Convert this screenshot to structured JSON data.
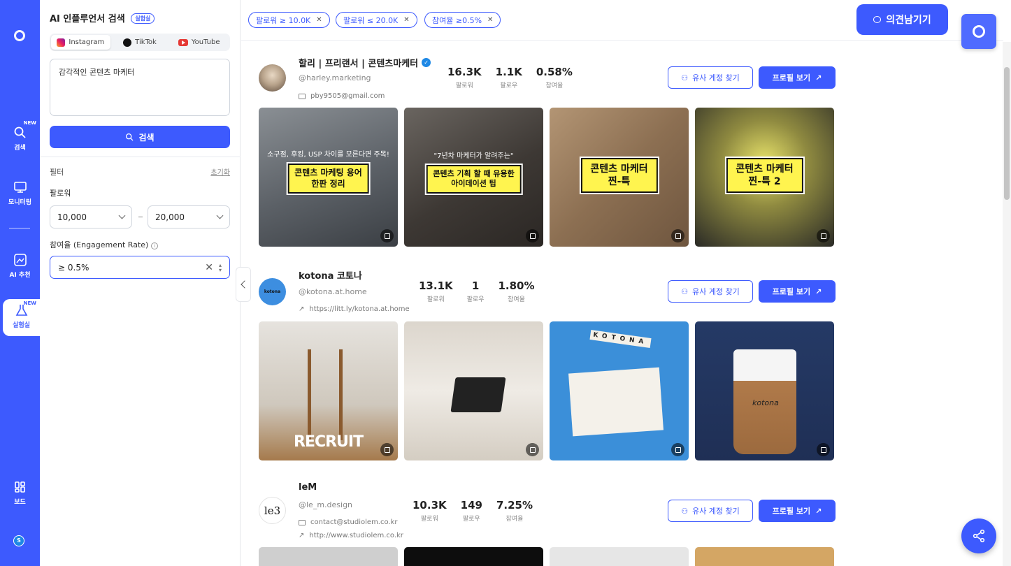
{
  "nav": {
    "items": [
      {
        "label": "검색",
        "badge": "NEW"
      },
      {
        "label": "모니터링",
        "badge": ""
      },
      {
        "label": "AI 추천",
        "badge": ""
      },
      {
        "label": "실험실",
        "badge": "NEW"
      },
      {
        "label": "보드",
        "badge": ""
      }
    ],
    "avatar": "S"
  },
  "panel": {
    "title": "AI 인플루언서 검색",
    "beta": "실험실",
    "platforms": [
      "Instagram",
      "TikTok",
      "YouTube"
    ],
    "query": "감각적인 콘텐츠 마케터",
    "search_label": "검색",
    "filter_label": "필터",
    "reset_label": "초기화",
    "followers_label": "팔로워",
    "followers_min": "10,000",
    "followers_max": "20,000",
    "engagement_label": "참여율 (Engagement Rate)",
    "engagement_value": "≥ 0.5%"
  },
  "chips": [
    "팔로워 ≥ 10.0K",
    "팔로워 ≤ 20.0K",
    "참여율 ≥0.5%"
  ],
  "feedback_label": "의견남기기",
  "buttons": {
    "similar": "유사 계정 찾기",
    "profile": "프로필 보기"
  },
  "stat_labels": {
    "followers": "팔로워",
    "following": "팔로우",
    "engagement": "참여율"
  },
  "profiles": [
    {
      "name": "할리 | 프리랜서 | 콘텐츠마케터",
      "handle": "@harley.marketing",
      "meta": [
        "pby9505@gmail.com"
      ],
      "followers": "16.3K",
      "following": "1.1K",
      "engagement": "0.58%",
      "posts": [
        {
          "top": "소구점, 후킹, USP 차이를 모른다면 주목!",
          "caption": "콘텐츠 마케팅 용어\n한판 정리"
        },
        {
          "top": "\"7년차 마케터가 알려주는\"",
          "caption": "콘텐츠 기획 할 때 유용한\n아이데이션 팁"
        },
        {
          "top": "",
          "caption": "콘텐츠 마케터\n찐-특"
        },
        {
          "top": "",
          "caption": "콘텐츠 마케터\n찐-특 2"
        }
      ]
    },
    {
      "name": "kotona 코토나",
      "handle": "@kotona.at.home",
      "meta": [
        "https://litt.ly/kotona.at.home"
      ],
      "followers": "13.1K",
      "following": "1",
      "engagement": "1.80%",
      "posts": [
        {
          "text": "RECRUIT"
        },
        {
          "text": ""
        },
        {
          "text": "KOTONA"
        },
        {
          "text": "kotona"
        }
      ]
    },
    {
      "name": "leM",
      "handle": "@le_m.design",
      "meta": [
        "contact@studiolem.co.kr",
        "http://www.studiolem.co.kr"
      ],
      "followers": "10.3K",
      "following": "149",
      "engagement": "7.25%"
    }
  ]
}
